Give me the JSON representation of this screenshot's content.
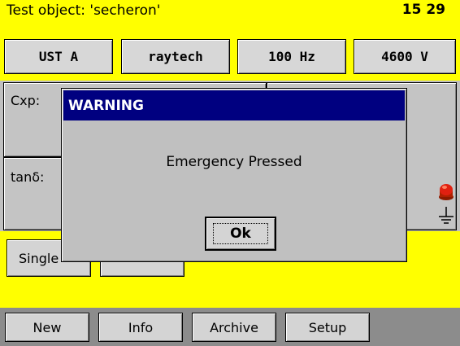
{
  "header": {
    "title": "Test object: 'secheron'",
    "time": "15 29"
  },
  "toolbar": {
    "mode": "UST A",
    "source": "raytech",
    "frequency": "100 Hz",
    "voltage": "4600 V"
  },
  "measurements": {
    "cxp_label": "Cxp:",
    "tand_label": "tanδ:"
  },
  "actions": {
    "single_label": "Single"
  },
  "bottom_nav": {
    "new_label": "New",
    "info_label": "Info",
    "archive_label": "Archive",
    "setup_label": "Setup"
  },
  "dialog": {
    "title": "WARNING",
    "message": "Emergency Pressed",
    "ok_label": "Ok"
  },
  "indicators": {
    "emergency_icon": "emergency-stop-icon",
    "ground_icon": "ground-icon"
  },
  "colors": {
    "background": "#ffff00",
    "dialog_title_bg": "#000080",
    "emergency_red": "#e02010"
  }
}
